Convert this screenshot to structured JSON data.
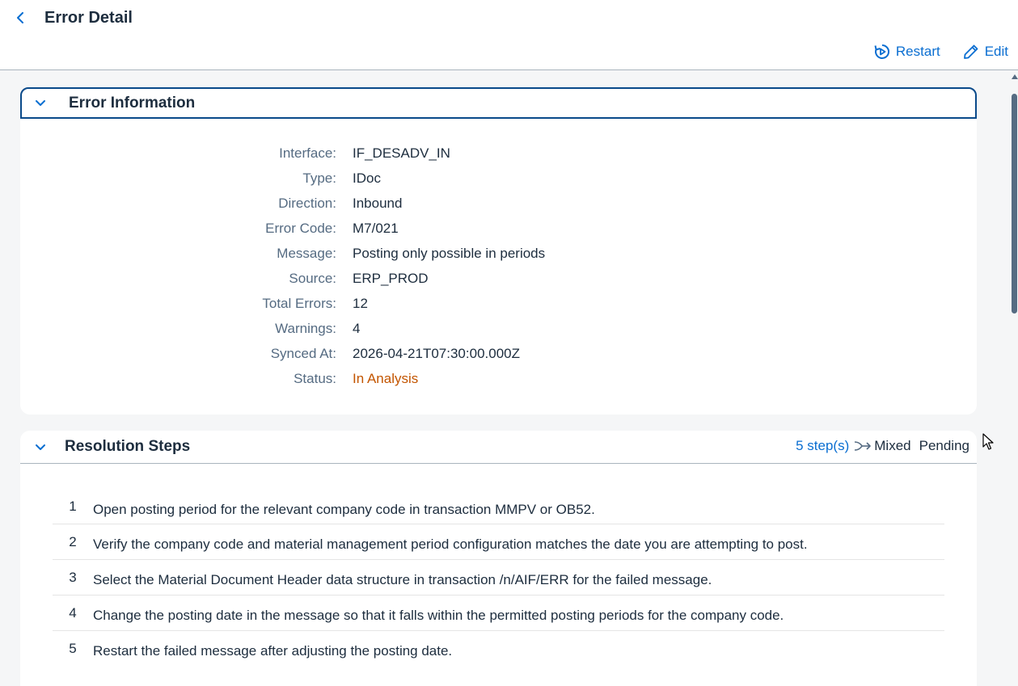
{
  "header": {
    "back_icon": "chevron-left-icon",
    "title": "Error Detail",
    "actions": {
      "restart_label": "Restart",
      "edit_label": "Edit"
    }
  },
  "error_info": {
    "title": "Error Information",
    "fields": [
      {
        "label": "Interface:",
        "value": "IF_DESADV_IN"
      },
      {
        "label": "Type:",
        "value": "IDoc"
      },
      {
        "label": "Direction:",
        "value": "Inbound"
      },
      {
        "label": "Error Code:",
        "value": "M7/021"
      },
      {
        "label": "Message:",
        "value": "Posting only possible in periods"
      },
      {
        "label": "Source:",
        "value": "ERP_PROD"
      },
      {
        "label": "Total Errors:",
        "value": "12"
      },
      {
        "label": "Warnings:",
        "value": "4"
      },
      {
        "label": "Synced At:",
        "value": "2026-04-21T07:30:00.000Z"
      },
      {
        "label": "Status:",
        "value": "In Analysis"
      }
    ]
  },
  "resolution": {
    "title": "Resolution Steps",
    "step_count": "5 step(s)",
    "mode": "Mixed",
    "state": "Pending",
    "steps": [
      {
        "num": "1",
        "text": "Open posting period for the relevant company code in transaction MMPV or OB52."
      },
      {
        "num": "2",
        "text": "Verify the company code and material management period configuration matches the date you are attempting to post."
      },
      {
        "num": "3",
        "text": "Select the Material Document Header data structure in transaction /n/AIF/ERR for the failed message."
      },
      {
        "num": "4",
        "text": "Change the posting date in the message so that it falls within the permitted posting periods for the company code."
      },
      {
        "num": "5",
        "text": "Restart the failed message after adjusting the posting date."
      }
    ]
  },
  "colors": {
    "accent": "#0a6ed1",
    "status_warning": "#c35500",
    "label": "#556b82",
    "text": "#1d2d3e"
  }
}
